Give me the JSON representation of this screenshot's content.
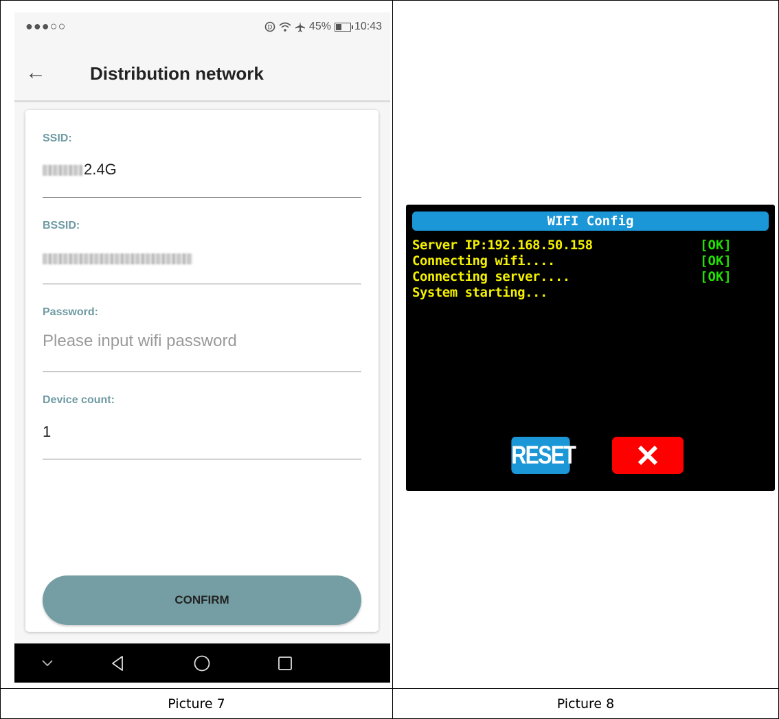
{
  "phone": {
    "status": {
      "signal": "●●●○○",
      "battery_level": 0.45,
      "battery_text": "45%",
      "time": "10:43"
    },
    "app_bar": {
      "title": "Distribution network"
    },
    "form": {
      "ssid_label": "SSID:",
      "ssid_value": "2.4G",
      "bssid_label": "BSSID:",
      "password_label": "Password:",
      "password_placeholder": "Please input wifi password",
      "device_count_label": "Device count:",
      "device_count_value": "1"
    },
    "confirm_label": "CONFIRM"
  },
  "lcd": {
    "title": "WIFI Config",
    "lines": [
      {
        "text": "Server IP:192.168.50.158",
        "status": "[OK]"
      },
      {
        "text": "Connecting wifi....",
        "status": "[OK]"
      },
      {
        "text": "Connecting server....",
        "status": "[OK]"
      },
      {
        "text": "System starting...",
        "status": ""
      }
    ],
    "reset_label": "RESET",
    "colors": {
      "title_bar": "#1b96d6",
      "text": "#f4f000",
      "ok": "#22e000",
      "close": "#ff0000"
    }
  },
  "captions": {
    "left": "Picture 7",
    "right": "Picture 8"
  }
}
